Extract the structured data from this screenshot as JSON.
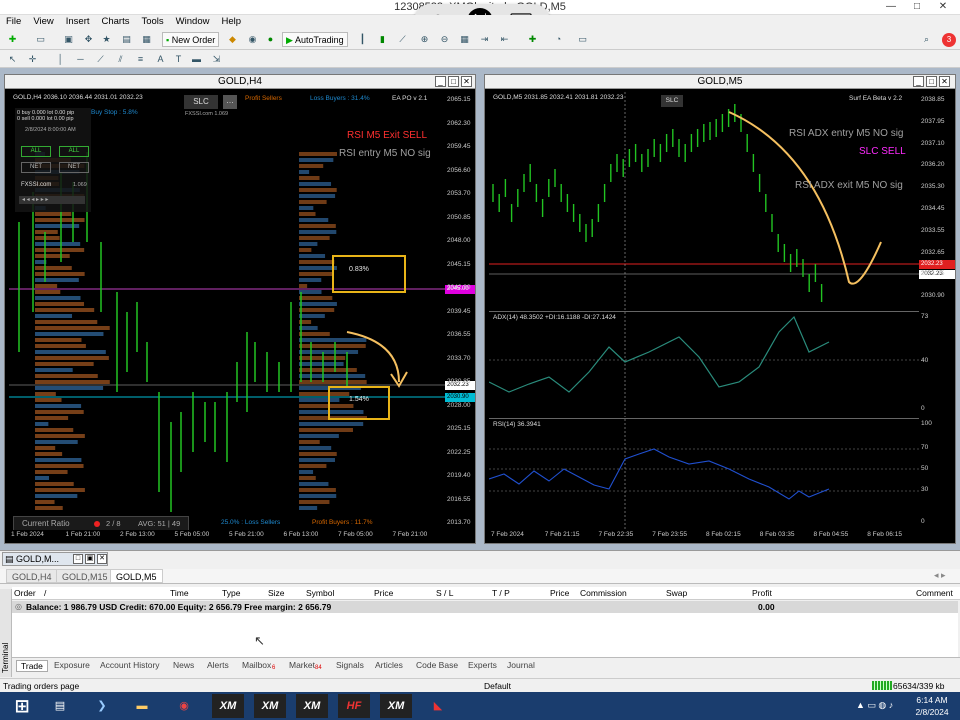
{
  "window": {
    "title": "12308523: XMGl",
    "title_suffix": "mited - GOLD,M5",
    "min": "—",
    "restore": "□",
    "close": "✕"
  },
  "overlay": {
    "zoom_icon": "⊕",
    "cursor_icon": "⇲",
    "keyboard_icon": "⌨"
  },
  "menu": [
    "File",
    "View",
    "Insert",
    "Charts",
    "Tools",
    "Window",
    "Help"
  ],
  "toolbar": {
    "new_order": "New Order",
    "autotrading": "AutoTrading",
    "notify_count": "3"
  },
  "h4": {
    "title": "GOLD,H4",
    "info": "GOLD,H4  2036.10 2036.44 2031.01 2032.23",
    "slc": "SLC",
    "profit_sellers": "Profit Sellers",
    "loss_buyers": "Loss Buyers : 31.4%",
    "ea": "EA PO v 2.1",
    "buy_stop": "Buy Stop : 5.8%",
    "panel_buy": "0 buy 0.000 lot  0.00 pip",
    "panel_sell": "0 sell 0.000 lot  0.00 pip",
    "panel_date": "2/8/2024 8:00:00 AM",
    "panel_all1": "ALL",
    "panel_all2": "ALL",
    "panel_net1": "NET",
    "panel_net2": "NET",
    "panel_brand": "FXSSI.com",
    "panel_ver": "1.069",
    "fxssi_small": "FXSSI.com 1.069",
    "rsi_exit": "RSI M5 Exit SELL",
    "rsi_entry": "RSI entry M5 NO sig",
    "box1_pct": "0.83%",
    "box2_pct": "1.54%",
    "current_ratio": "Current Ratio",
    "ratio_count": "2 / 8",
    "avg": "AVG: 51 | 49",
    "loss_sellers": "25.0% : Loss Sellers",
    "profit_buyers": "Profit Buyers : 11.7%",
    "price_tag_mag": "2045.00",
    "price_tag_cur": "2032.23",
    "price_tag_cyan": "2030.90",
    "yticks": [
      "2065.15",
      "2062.30",
      "2059.45",
      "2056.60",
      "2053.70",
      "2050.85",
      "2048.00",
      "2045.15",
      "2042.30",
      "2039.45",
      "2036.55",
      "2033.70",
      "2030.85",
      "2028.00",
      "2025.15",
      "2022.25",
      "2019.40",
      "2016.55",
      "2013.70"
    ],
    "xticks": [
      "1 Feb 2024",
      "1 Feb 21:00",
      "2 Feb 13:00",
      "5 Feb 05:00",
      "5 Feb 21:00",
      "6 Feb 13:00",
      "7 Feb 05:00",
      "7 Feb 21:00"
    ]
  },
  "m5": {
    "title": "GOLD,M5",
    "info": "GOLD,M5  2031.85 2032.41 2031.81 2032.23",
    "slc": "SLC",
    "ea": "Surf EA Beta v 2.2",
    "rsi_adx_entry": "RSI ADX entry M5 NO sig",
    "slc_sell": "SLC SELL",
    "rsi_adx_exit": "RSI ADX exit M5 NO sig",
    "price_tag_red": "2032.23",
    "price_tag_cur": "2032.23",
    "yticks": [
      "2038.85",
      "2037.95",
      "2037.10",
      "2036.20",
      "2035.30",
      "2034.45",
      "2033.55",
      "2032.65",
      "2031.75",
      "2030.90"
    ],
    "adx_label": "ADX(14) 48.3502 +DI:16.1188 -DI:27.1424",
    "adx_ticks": [
      "73",
      "40",
      "0"
    ],
    "rsi_label": "RSI(14) 36.3941",
    "rsi_ticks": [
      "100",
      "70",
      "50",
      "30",
      "0"
    ],
    "xticks": [
      "7 Feb 2024",
      "7 Feb 21:15",
      "7 Feb 22:35",
      "7 Feb 23:55",
      "8 Feb 02:15",
      "8 Feb 03:35",
      "8 Feb 04:55",
      "8 Feb 06:15"
    ]
  },
  "terminal": {
    "title": "GOLD,M...",
    "chart_tabs": [
      "GOLD,H4",
      "GOLD,M15",
      "GOLD,M5"
    ],
    "side_label": "Terminal",
    "columns": [
      "Order",
      "/",
      "Time",
      "Type",
      "Size",
      "Symbol",
      "Price",
      "S / L",
      "T / P",
      "Price",
      "Commission",
      "Swap",
      "Profit",
      "Comment"
    ],
    "balance_row": "Balance: 1 986.79 USD  Credit: 670.00  Equity: 2 656.79  Free margin: 2 656.79",
    "profit": "0.00",
    "bottom_tabs": [
      "Trade",
      "Exposure",
      "Account History",
      "News",
      "Alerts",
      "Mailbox",
      "Market",
      "Signals",
      "Articles",
      "Code Base",
      "Experts",
      "Journal"
    ],
    "mailbox_badge": "6",
    "market_badge": "84"
  },
  "status": {
    "left": "Trading orders page",
    "profile": "Default",
    "traffic": "65634/339 kb"
  },
  "taskbar": {
    "time": "6:14 AM",
    "date": "2/8/2024",
    "apps": [
      "XM",
      "XM",
      "XM",
      "HF",
      "XM"
    ]
  }
}
